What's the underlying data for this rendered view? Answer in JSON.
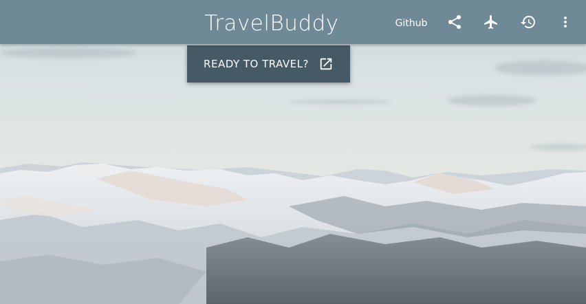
{
  "header": {
    "title": "TravelBuddy",
    "github_label": "Github",
    "background_color": "#6f8a96",
    "actions": [
      {
        "icon": "share-icon"
      },
      {
        "icon": "airplane-icon"
      },
      {
        "icon": "history-icon"
      },
      {
        "icon": "more-vert-icon"
      }
    ]
  },
  "hero": {
    "button_label": "READY TO TRAVEL?",
    "button_icon": "open-in-new-icon",
    "button_color": "#455a64",
    "background_image": "snowy-mountains-landscape"
  }
}
